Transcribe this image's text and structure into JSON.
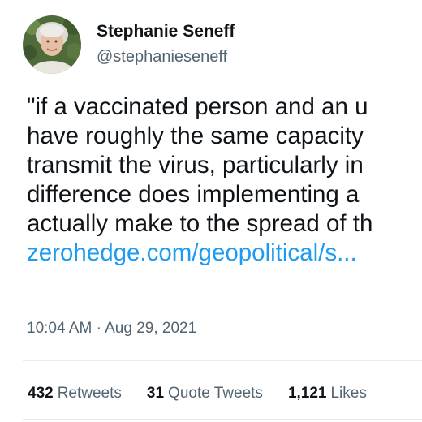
{
  "author": {
    "name": "Stephanie Seneff",
    "handle": "@stephanieseneff",
    "avatar_icon": "profile-photo"
  },
  "tweet": {
    "lines": [
      "\"if a vaccinated person and an u",
      "have roughly the same capacity",
      "transmit the virus, particularly in",
      "difference does implementing a",
      "actually make to the spread of th"
    ],
    "link_text": "zerohedge.com/geopolitical/s..."
  },
  "meta": {
    "time": "10:04 AM",
    "separator": "·",
    "date": "Aug 29, 2021"
  },
  "stats": {
    "retweets_count": "432",
    "retweets_label": "Retweets",
    "quotes_count": "31",
    "quotes_label": "Quote Tweets",
    "likes_count": "1,121",
    "likes_label": "Likes"
  },
  "colors": {
    "text": "#0f1419",
    "secondary": "#536471",
    "link": "#1d9bf0"
  }
}
